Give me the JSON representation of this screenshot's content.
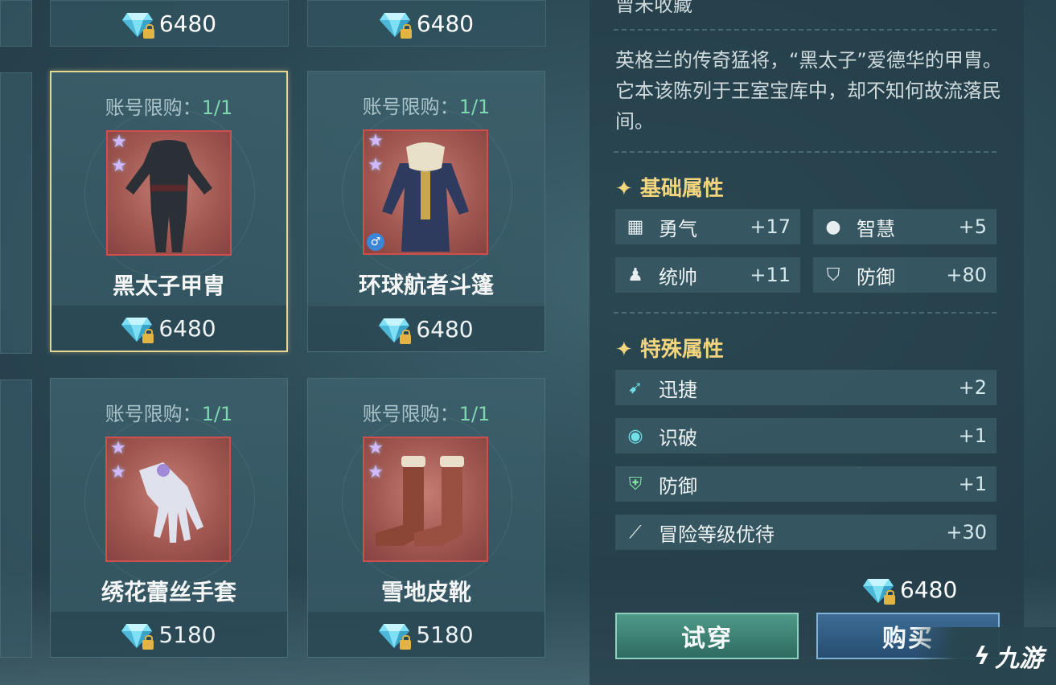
{
  "shop": {
    "top_prices": [
      "6480",
      "6480"
    ],
    "cards": [
      {
        "limit_label": "账号限购：",
        "limit_value": "1/1",
        "name": "黑太子甲胄",
        "price": "6480",
        "stars": 2,
        "selected": true,
        "gender_icon": false
      },
      {
        "limit_label": "账号限购：",
        "limit_value": "1/1",
        "name": "环球航者斗篷",
        "price": "6480",
        "stars": 2,
        "selected": false,
        "gender_icon": true
      },
      {
        "limit_label": "账号限购：",
        "limit_value": "1/1",
        "name": "绣花蕾丝手套",
        "price": "5180",
        "stars": 2,
        "selected": false,
        "gender_icon": false
      },
      {
        "limit_label": "账号限购：",
        "limit_value": "1/1",
        "name": "雪地皮靴",
        "price": "5180",
        "stars": 2,
        "selected": false,
        "gender_icon": false
      }
    ]
  },
  "detail": {
    "top_cut_text": "曾未收藏",
    "description": "英格兰的传奇猛将，“黑太子”爱德华的甲胄。它本该陈列于王室宝库中，却不知何故流落民间。",
    "basic_title": "基础属性",
    "basic_stats": [
      {
        "label": "勇气",
        "value": "+17",
        "icon": "courage-icon"
      },
      {
        "label": "智慧",
        "value": "+5",
        "icon": "wisdom-icon"
      },
      {
        "label": "统帅",
        "value": "+11",
        "icon": "leadership-icon"
      },
      {
        "label": "防御",
        "value": "+80",
        "icon": "shield-icon"
      }
    ],
    "special_title": "特殊属性",
    "special_stats": [
      {
        "label": "迅捷",
        "value": "+2",
        "icon": "agility-icon"
      },
      {
        "label": "识破",
        "value": "+1",
        "icon": "insight-icon"
      },
      {
        "label": "防御",
        "value": "+1",
        "icon": "defense-icon"
      },
      {
        "label": "冒险等级优待",
        "value": "+30",
        "icon": "telescope-icon"
      }
    ],
    "price": "6480",
    "try_on_label": "试穿",
    "buy_label": "购买"
  },
  "watermark": "九游",
  "colors": {
    "accent_gold": "#f2d57c",
    "limit_green": "#7fd7b0",
    "card_border_selected": "#e8d58f"
  }
}
